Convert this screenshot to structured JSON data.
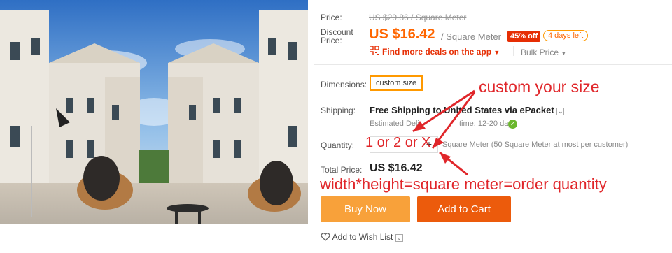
{
  "price": {
    "label": "Price:",
    "original": "US $29.86 / Square Meter",
    "discount_label_1": "Discount",
    "discount_label_2": "Price:",
    "current": "US $16.42",
    "unit": "/ Square Meter",
    "off_badge": "45% off",
    "days_badge": "4 days left"
  },
  "deals": {
    "app_link": "Find more deals on the app",
    "bulk_price": "Bulk Price"
  },
  "dimensions": {
    "label": "Dimensions:",
    "option": "custom size"
  },
  "shipping": {
    "label": "Shipping:",
    "main": "Free Shipping to United States via ePacket",
    "estimate_prefix": "Estimated Deli",
    "estimate_time": "time: 12-20 days"
  },
  "quantity": {
    "label": "Quantity:",
    "plus": "+",
    "note": "Square Meter (50 Square Meter at most per customer)"
  },
  "total": {
    "label": "Total Price:",
    "value": "US $16.42"
  },
  "annotations": {
    "custom": "custom your size",
    "qty": "1 or 2 or X",
    "formula": "width*height=square meter=order quantity"
  },
  "buttons": {
    "buy": "Buy Now",
    "cart": "Add to Cart"
  },
  "wishlist": {
    "label": "Add to Wish List"
  },
  "colors": {
    "accent_orange": "#f60",
    "buy_button": "#f8a13a",
    "cart_button": "#ec5b0c",
    "annotation_red": "#e0262a"
  }
}
